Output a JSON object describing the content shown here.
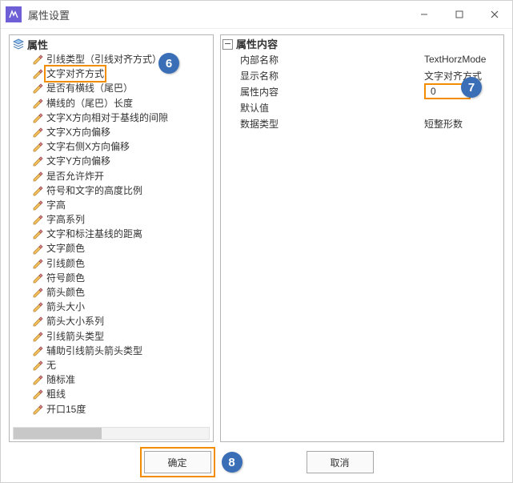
{
  "window": {
    "title": "属性设置"
  },
  "win_controls": {
    "min": "min",
    "max": "max",
    "close": "close"
  },
  "tree": {
    "root": "属性",
    "items": [
      "引线类型（引线对齐方式）",
      "文字对齐方式",
      "是否有横线（尾巴）",
      "横线的（尾巴）长度",
      "文字X方向相对于基线的间隙",
      "文字X方向偏移",
      "文字右侧X方向偏移",
      "文字Y方向偏移",
      "是否允许炸开",
      "符号和文字的高度比例",
      "字高",
      "字高系列",
      "文字和标注基线的距离",
      "文字颜色",
      "引线颜色",
      "符号颜色",
      "箭头颜色",
      "箭头大小",
      "箭头大小系列",
      "引线箭头类型",
      "辅助引线箭头箭头类型",
      "无",
      "随标准",
      "粗线",
      "开口15度"
    ],
    "highlight_index": 1
  },
  "details": {
    "header": "属性内容",
    "rows": [
      {
        "k": "内部名称",
        "v": "TextHorzMode"
      },
      {
        "k": "显示名称",
        "v": "文字对齐方式"
      },
      {
        "k": "属性内容",
        "v": "0",
        "boxed": true
      },
      {
        "k": "默认值",
        "v": ""
      },
      {
        "k": "数据类型",
        "v": "短整形数"
      }
    ]
  },
  "buttons": {
    "ok": "确定",
    "cancel": "取消"
  },
  "annotations": {
    "b6": "6",
    "b7": "7",
    "b8": "8"
  }
}
